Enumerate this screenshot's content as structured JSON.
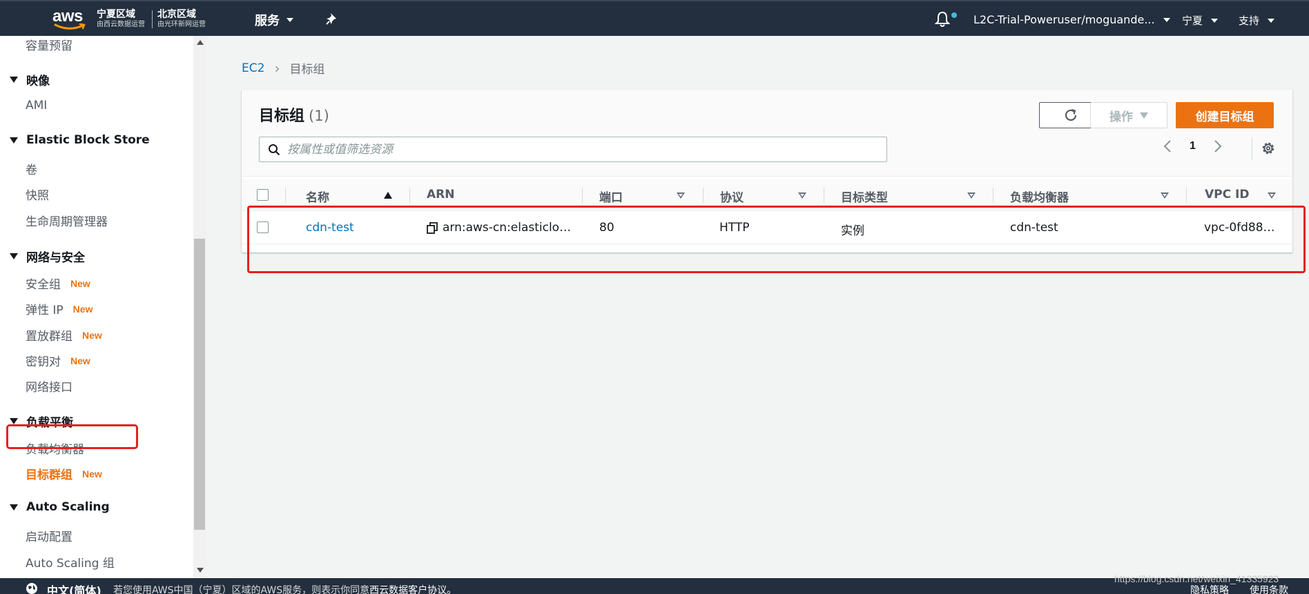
{
  "topnav": {
    "logo_text": "aws",
    "region1": {
      "name": "宁夏区域",
      "sub": "由西云数据运营"
    },
    "region2": {
      "name": "北京区域",
      "sub": "由光环新网运营"
    },
    "services_label": "服务",
    "user_label": "L2C-Trial-Poweruser/moguande...",
    "region_label": "宁夏",
    "support_label": "支持",
    "icons": [
      "pin-icon",
      "bell-icon"
    ]
  },
  "sidebar": {
    "items": [
      {
        "label": "容量预留"
      },
      {
        "section": "映像"
      },
      {
        "label": "AMI"
      },
      {
        "section": "Elastic Block Store"
      },
      {
        "label": "卷"
      },
      {
        "label": "快照"
      },
      {
        "label": "生命周期管理器"
      },
      {
        "section": "网络与安全"
      },
      {
        "label": "安全组",
        "badge": "New"
      },
      {
        "label": "弹性 IP",
        "badge": "New"
      },
      {
        "label": "置放群组",
        "badge": "New"
      },
      {
        "label": "密钥对",
        "badge": "New"
      },
      {
        "label": "网络接口"
      },
      {
        "section": "负载平衡"
      },
      {
        "label": "负载均衡器"
      },
      {
        "label": "目标群组",
        "badge": "New",
        "active": true
      },
      {
        "section": "Auto Scaling"
      },
      {
        "label": "启动配置"
      },
      {
        "label": "Auto Scaling 组"
      }
    ]
  },
  "breadcrumb": {
    "root": "EC2",
    "current": "目标组"
  },
  "panel": {
    "title": "目标组",
    "count": "(1)",
    "actions_label": "操作",
    "create_label": "创建目标组",
    "search_placeholder": "按属性或值筛选资源",
    "page_number": "1"
  },
  "table": {
    "columns": [
      "名称",
      "ARN",
      "端口",
      "协议",
      "目标类型",
      "负载均衡器",
      "VPC ID"
    ],
    "rows": [
      {
        "name": "cdn-test",
        "arn": "arn:aws-cn:elasticlo…",
        "port": "80",
        "protocol": "HTTP",
        "target_type": "实例",
        "load_balancer": "cdn-test",
        "vpc_id": "vpc-0fd88…"
      }
    ]
  },
  "footer": {
    "language": "中文(简体)",
    "note_prefix": "若您使用AWS中国（宁夏）区域的AWS服务，则表示你同意",
    "note_link": "西云数据客户协议。",
    "privacy": "隐私策略",
    "terms": "使用条款"
  },
  "watermark": "https://blog.csdn.net/weixin_41335923",
  "colors": {
    "nav_bg": "#232f3e",
    "accent_orange": "#ec7211",
    "link_blue": "#0073bb",
    "highlight_red": "#e6201f"
  }
}
